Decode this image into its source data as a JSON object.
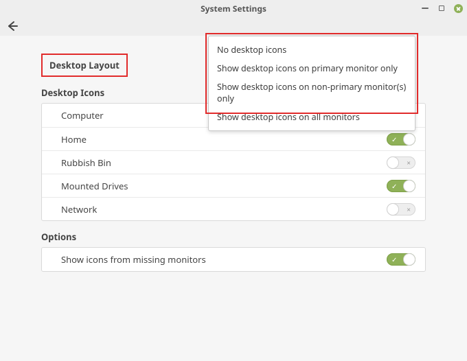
{
  "window": {
    "title": "System Settings"
  },
  "section_title": "Desktop Layout",
  "groups": {
    "icons_header": "Desktop Icons",
    "options_header": "Options"
  },
  "icons": {
    "computer": {
      "label": "Computer",
      "on": false,
      "has_toggle": false
    },
    "home": {
      "label": "Home",
      "on": true
    },
    "rubbish_bin": {
      "label": "Rubbish Bin",
      "on": false
    },
    "mounted_drives": {
      "label": "Mounted Drives",
      "on": true
    },
    "network": {
      "label": "Network",
      "on": false
    }
  },
  "options": {
    "missing_monitors": {
      "label": "Show icons from missing monitors",
      "on": true
    }
  },
  "dropdown": {
    "items": [
      "No desktop icons",
      "Show desktop icons on primary monitor only",
      "Show desktop icons on non-primary monitor(s) only",
      "Show desktop icons on all monitors"
    ]
  },
  "marks": {
    "on": "✓",
    "off": "×"
  },
  "highlight": {
    "section_title": true,
    "dropdown": true
  }
}
